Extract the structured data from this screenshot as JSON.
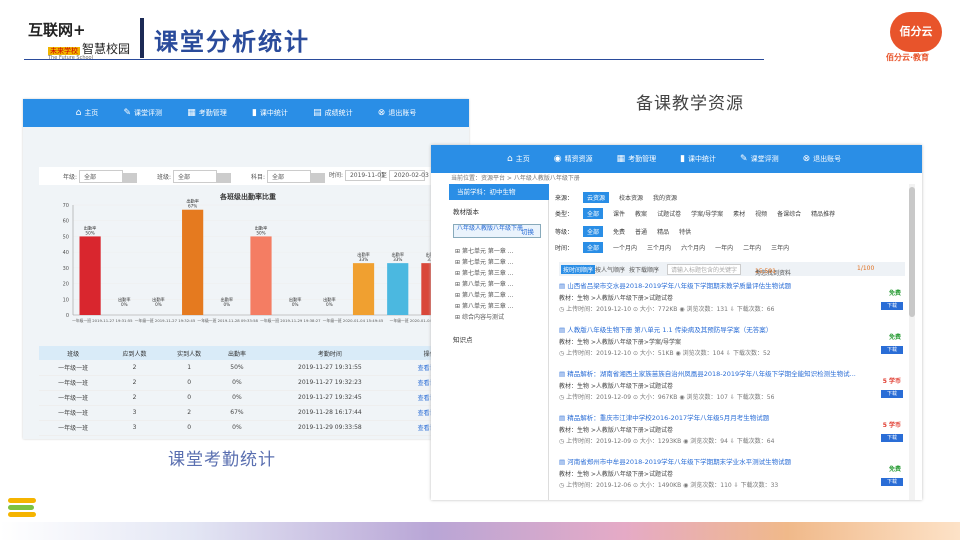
{
  "header": {
    "logo_line1": "互联网+",
    "logo_tag": "未来学校",
    "logo_line2": "智慧校园",
    "logo_line3": "The Future School",
    "title": "课堂分析统计",
    "brand_name": "佰分云",
    "brand_sub": "佰分云·教育"
  },
  "captions": {
    "left": "课堂考勤统计",
    "right": "备课教学资源"
  },
  "left_panel": {
    "nav": [
      {
        "icon": "home-icon",
        "label": "主页"
      },
      {
        "icon": "edit-icon",
        "label": "课堂评测"
      },
      {
        "icon": "calendar-icon",
        "label": "考勤管理"
      },
      {
        "icon": "bar-chart-icon",
        "label": "课中统计"
      },
      {
        "icon": "stats-icon",
        "label": "成绩统计"
      },
      {
        "icon": "logout-icon",
        "label": "退出账号"
      }
    ],
    "filters": {
      "grade_label": "年级:",
      "grade_value": "全部",
      "class_label": "班级:",
      "class_value": "全部",
      "subject_label": "科目:",
      "subject_value": "全部",
      "time_label": "时间:",
      "time_start": "2019-11-01",
      "time_sep": "至",
      "time_end": "2020-02-03"
    },
    "table": {
      "headers": [
        "班级",
        "应到人数",
        "实到人数",
        "出勤率",
        "考勤时间",
        "操作"
      ],
      "rows": [
        [
          "一年级一班",
          "2",
          "1",
          "50%",
          "2019-11-27 19:31:55",
          "查看详情"
        ],
        [
          "一年级一班",
          "2",
          "0",
          "0%",
          "2019-11-27 19:32:23",
          "查看详情"
        ],
        [
          "一年级一班",
          "2",
          "0",
          "0%",
          "2019-11-27 19:32:45",
          "查看详情"
        ],
        [
          "一年级一班",
          "3",
          "2",
          "67%",
          "2019-11-28 16:17:44",
          "查看详情"
        ],
        [
          "一年级一班",
          "3",
          "0",
          "0%",
          "2019-11-29 09:33:58",
          "查看详情"
        ]
      ]
    }
  },
  "chart_data": {
    "type": "bar",
    "title": "各班级出勤率比重",
    "ylim": [
      0,
      70
    ],
    "yticks": [
      "0",
      "10",
      "20",
      "30",
      "40",
      "50",
      "60",
      "70"
    ],
    "bar_label_prefix": "出勤率",
    "categories": [
      "一年级一班 2019-11-27 19:31:55",
      "一年级一班 2019-11-27 19:32:45",
      "一年级一班 2019-11-28 16:17:44",
      "一年级一班 2019-11-29 09:33:58",
      "一年级一班 2019-11-29 19:38:27",
      "一年级一班 2020-01-04 15:49:45",
      "一年级一班 2020-01-04 16:05:14",
      "一年级一班 2020-01-04 16:10:00"
    ],
    "groups": [
      {
        "values": [
          50,
          0,
          0
        ],
        "colors": [
          "#d9262e",
          "#888888",
          "#888888"
        ]
      },
      {
        "values": [
          67,
          0
        ],
        "colors": [
          "#e57a1f",
          "#888888"
        ]
      },
      {
        "values": [
          50,
          0,
          0
        ],
        "colors": [
          "#f47d63",
          "#888888",
          "#888888"
        ]
      },
      {
        "values": [
          33,
          33,
          33
        ],
        "colors": [
          "#f0a030",
          "#4bb8e0",
          "#d9473a"
        ]
      }
    ],
    "label_texts": [
      "50%",
      "0%",
      "0%",
      "67%",
      "0%",
      "50%",
      "0%",
      "0%",
      "33%",
      "33%",
      "33%"
    ],
    "xlabels": [
      "一年级一班\n2019-11-27 19:31:55",
      "一年级一班\n2019-11-27 19:32:45",
      "一年级一班\n2019-11-28 09:33:58",
      "一年级一班\n2019-11-29 19:38:27",
      "一年级一班\n2020-01-04 15:49:45",
      "一年级一班\n2020-01-04 16:0"
    ]
  },
  "right_panel": {
    "nav": [
      {
        "icon": "home-icon",
        "label": "主页"
      },
      {
        "icon": "resource-icon",
        "label": "精资资源"
      },
      {
        "icon": "calendar-icon",
        "label": "考勤管理"
      },
      {
        "icon": "bar-chart-icon",
        "label": "课中统计"
      },
      {
        "icon": "edit-icon",
        "label": "课堂评测"
      },
      {
        "icon": "logout-icon",
        "label": "退出账号"
      }
    ],
    "breadcrumb": "当前位置：资源平台 > 八年级人教版八年级下册",
    "subject": "当前学科：初中生物",
    "textbook_label": "教材版本",
    "textbook_value": "八年级人教版八年级下册",
    "switch_label": "切换",
    "tree": [
      "第七单元 第一章 ...",
      "第七单元 第二章 ...",
      "第七单元 第三章 ...",
      "第八单元 第一章 ...",
      "第八单元 第二章 ...",
      "第八单元 第三章 ...",
      "综合内容与测试"
    ],
    "knowledge_label": "知识点",
    "filters": {
      "source_label": "来源：",
      "source_options": [
        "云资源",
        "校本资源",
        "我的资源"
      ],
      "type_label": "类型：",
      "type_options": [
        "全部",
        "课件",
        "教案",
        "试题试卷",
        "学案/导学案",
        "素材",
        "视频",
        "备课综合",
        "精品推荐"
      ],
      "grade_label": "等级：",
      "grade_options": [
        "全部",
        "免费",
        "普通",
        "精品",
        "特供"
      ],
      "time_label": "时间：",
      "time_options": [
        "全部",
        "一个月内",
        "三个月内",
        "六个月内",
        "一年内",
        "二年内",
        "三年内"
      ]
    },
    "sortbar": {
      "sort_time": "按时间顺序",
      "sort_pop": "按人气顺序",
      "sort_dl": "按下载顺序",
      "search_placeholder": "请输入标题包含的关键字",
      "found_prefix": "为您找到资料",
      "found_count": "15,591",
      "found_suffix": "个",
      "page": "1/100"
    },
    "results": [
      {
        "title": "山西省吕梁市交水县2018-2019学年八年级下学期期末教学质量评估生物试题",
        "meta": "教材：生物 >人教版八年级下册>试题试卷",
        "date": "上传时间：2019-12-10",
        "size": "大小：772KB",
        "views": "浏览次数：131",
        "downloads": "下载次数：66",
        "price": "免费",
        "dl": "下载"
      },
      {
        "title": "人教版八年级生物下册 第八单元 1.1 传染病及其预防导学案（无答案）",
        "meta": "教材：生物 >人教版八年级下册>学案/导学案",
        "date": "上传时间：2019-12-10",
        "size": "大小：51KB",
        "views": "浏览次数：104",
        "downloads": "下载次数：52",
        "price": "免费",
        "dl": "下载"
      },
      {
        "title": "精品解析：湖南省湘西土家族苗族自治州凤凰县2018-2019学年八年级下学期全能知识检测生物试...",
        "meta": "教材：生物 >人教版八年级下册>试题试卷",
        "date": "上传时间：2019-12-09",
        "size": "大小：967KB",
        "views": "浏览次数：107",
        "downloads": "下载次数：56",
        "price": "5 学币",
        "dl": "下载"
      },
      {
        "title": "精品解析：重庆市江津中学校2016-2017学年八年级5月月考生物试题",
        "meta": "教材：生物 >人教版八年级下册>试题试卷",
        "date": "上传时间：2019-12-09",
        "size": "大小：1293KB",
        "views": "浏览次数：94",
        "downloads": "下载次数：64",
        "price": "5 学币",
        "dl": "下载"
      },
      {
        "title": "河南省郑州市中牟县2018-2019学年八年级下学期期末学业水平测试生物试题",
        "meta": "教材：生物 >人教版八年级下册>试题试卷",
        "date": "上传时间：2019-12-06",
        "size": "大小：1490KB",
        "views": "浏览次数：110",
        "downloads": "下载次数：33",
        "price": "免费",
        "dl": "下载"
      }
    ]
  },
  "colors": {
    "nav_blue": "#2a8ee6",
    "title_blue": "#2a4b9b",
    "link_blue": "#2a6dd6",
    "free_green": "#2e9e3a",
    "price_red": "#e03a2e"
  }
}
